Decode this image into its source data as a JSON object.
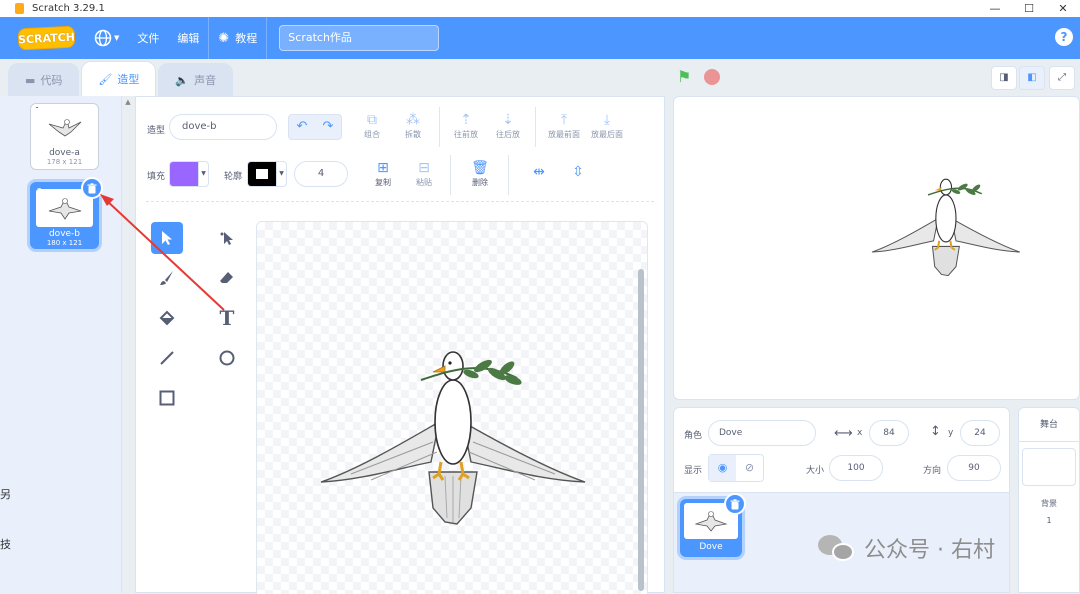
{
  "window": {
    "title": "Scratch 3.29.1",
    "minimize": "—",
    "maximize": "☐",
    "close": "✕"
  },
  "menubar": {
    "logo": "SCRATCH",
    "language_icon": "globe-icon",
    "file": "文件",
    "edit": "编辑",
    "tutorials": "教程",
    "project_title": "Scratch作品",
    "help": "?"
  },
  "tabs": {
    "code": "代码",
    "costumes": "造型",
    "sounds": "声音"
  },
  "costumes": [
    {
      "number": "1",
      "name": "dove-a",
      "size": "178 x 121"
    },
    {
      "number": "2",
      "name": "dove-b",
      "size": "180 x 121"
    }
  ],
  "editor": {
    "costume_label": "造型",
    "costume_name": "dove-b",
    "group": "组合",
    "ungroup": "拆散",
    "forward": "往前放",
    "backward": "往后放",
    "front": "放最前面",
    "back": "放最后面",
    "fill_label": "填充",
    "fill_color": "#9966ff",
    "outline_label": "轮廓",
    "outline_width": "4",
    "copy": "复制",
    "paste": "粘贴",
    "delete": "删除"
  },
  "sprite_info": {
    "sprite_label": "角色",
    "sprite_name": "Dove",
    "x_label": "x",
    "x_value": "84",
    "y_label": "y",
    "y_value": "24",
    "show_label": "显示",
    "size_label": "大小",
    "size_value": "100",
    "direction_label": "方向",
    "direction_value": "90"
  },
  "sprites": [
    {
      "name": "Dove"
    }
  ],
  "stage_panel": {
    "title": "舞台",
    "backdrops_label": "背景",
    "backdrops_count": "1"
  },
  "watermark": {
    "text": "公众号 · 右村"
  },
  "left_edge": {
    "char1": "另",
    "char2": "技"
  },
  "colors": {
    "accent": "#4c97ff",
    "menubar": "#4c97ff",
    "arrow": "#e53935",
    "fill": "#9966ff"
  }
}
